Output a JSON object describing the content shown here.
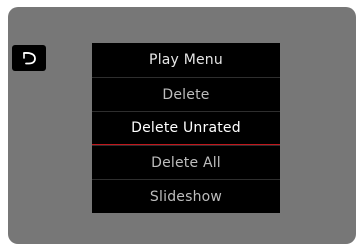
{
  "back": {
    "icon": "back-arrow-icon"
  },
  "menu": {
    "title": "Play Menu",
    "items": [
      {
        "label": "Delete"
      },
      {
        "label": "Delete Unrated",
        "selected": true
      },
      {
        "label": "Delete All"
      },
      {
        "label": "Slideshow"
      }
    ]
  },
  "colors": {
    "screen": "#777777",
    "menu": "#000000",
    "selection_line": "#c0181d"
  }
}
